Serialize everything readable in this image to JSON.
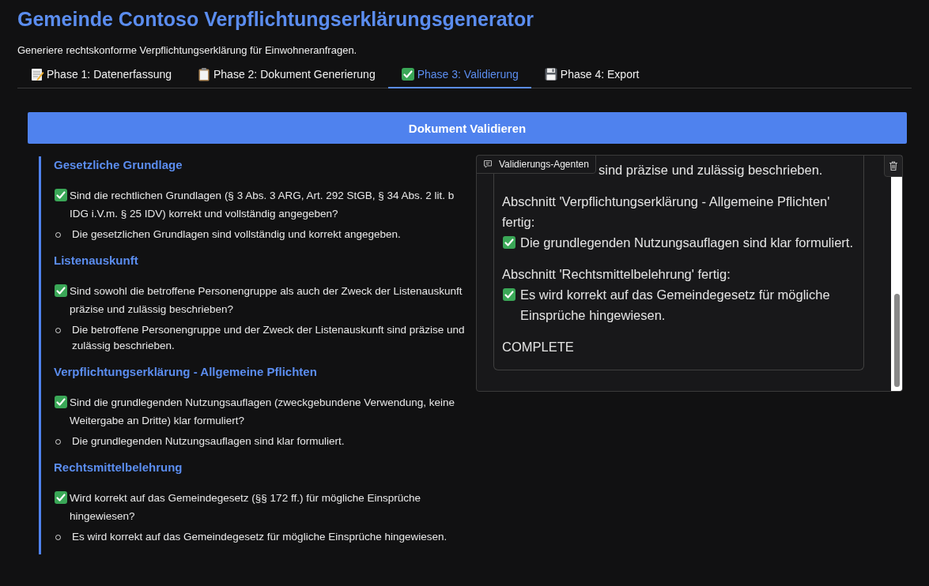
{
  "title": "Gemeinde Contoso Verpflichtungserklärungsgenerator",
  "subtitle": "Generiere rechtskonforme Verpflichtungserklärung für Einwohneranfragen.",
  "tabs": [
    {
      "label": "Phase 1: Datenerfassung",
      "kind": "notepad",
      "selected": false
    },
    {
      "label": "Phase 2: Dokument Generierung",
      "kind": "clipboard",
      "selected": false
    },
    {
      "label": "Phase 3: Validierung",
      "kind": "check",
      "selected": true
    },
    {
      "label": "Phase 4: Export",
      "kind": "floppy",
      "selected": false
    }
  ],
  "validate_button": "Dokument Validieren",
  "sections": [
    {
      "heading": "Gesetzliche Grundlage",
      "question": "Sind die rechtlichen Grundlagen (§ 3 Abs. 3 ARG, Art. 292 StGB, § 34 Abs. 2 lit. b IDG i.V.m. § 25 IDV) korrekt und vollständig angegeben?",
      "passed": true,
      "finding": "Die gesetzlichen Grundlagen sind vollständig und korrekt angegeben."
    },
    {
      "heading": "Listenauskunft",
      "question": "Sind sowohl die betroffene Personengruppe als auch der Zweck der Listenauskunft präzise und zulässig beschrieben?",
      "passed": true,
      "finding": "Die betroffene Personengruppe und der Zweck der Listenauskunft sind präzise und zulässig beschrieben."
    },
    {
      "heading": "Verpflichtungserklärung - Allgemeine Pflichten",
      "question": "Sind die grundlegenden Nutzungsauflagen (zweckgebundene Verwendung, keine Weitergabe an Dritte) klar formuliert?",
      "passed": true,
      "finding": "Die grundlegenden Nutzungsauflagen sind klar formuliert."
    },
    {
      "heading": "Rechtsmittelbelehrung",
      "question": "Wird korrekt auf das Gemeindegesetz (§§ 172 ff.) für mögliche Einsprüche hingewiesen?",
      "passed": true,
      "finding": "Es wird korrekt auf das Gemeindegesetz für mögliche Einsprüche hingewiesen."
    }
  ],
  "chat": {
    "label": "Validierungs-Agenten",
    "paragraphs": [
      {
        "lines": [
          {
            "kind": "partial",
            "text": "sind präzise und zulässig beschrieben."
          }
        ]
      },
      {
        "lines": [
          {
            "kind": "text",
            "text": "Abschnitt 'Verpflichtungserklärung - Allgemeine Pflichten' fertig:"
          },
          {
            "kind": "check",
            "text": "Die grundlegenden Nutzungsauflagen sind klar formuliert."
          }
        ]
      },
      {
        "lines": [
          {
            "kind": "text",
            "text": "Abschnitt 'Rechtsmittelbelehrung' fertig:"
          },
          {
            "kind": "check",
            "text": "Es wird korrekt auf das Gemeindegesetz für mögliche Einsprüche hingewiesen."
          }
        ]
      },
      {
        "lines": [
          {
            "kind": "text",
            "text": "COMPLETE"
          }
        ]
      }
    ]
  }
}
